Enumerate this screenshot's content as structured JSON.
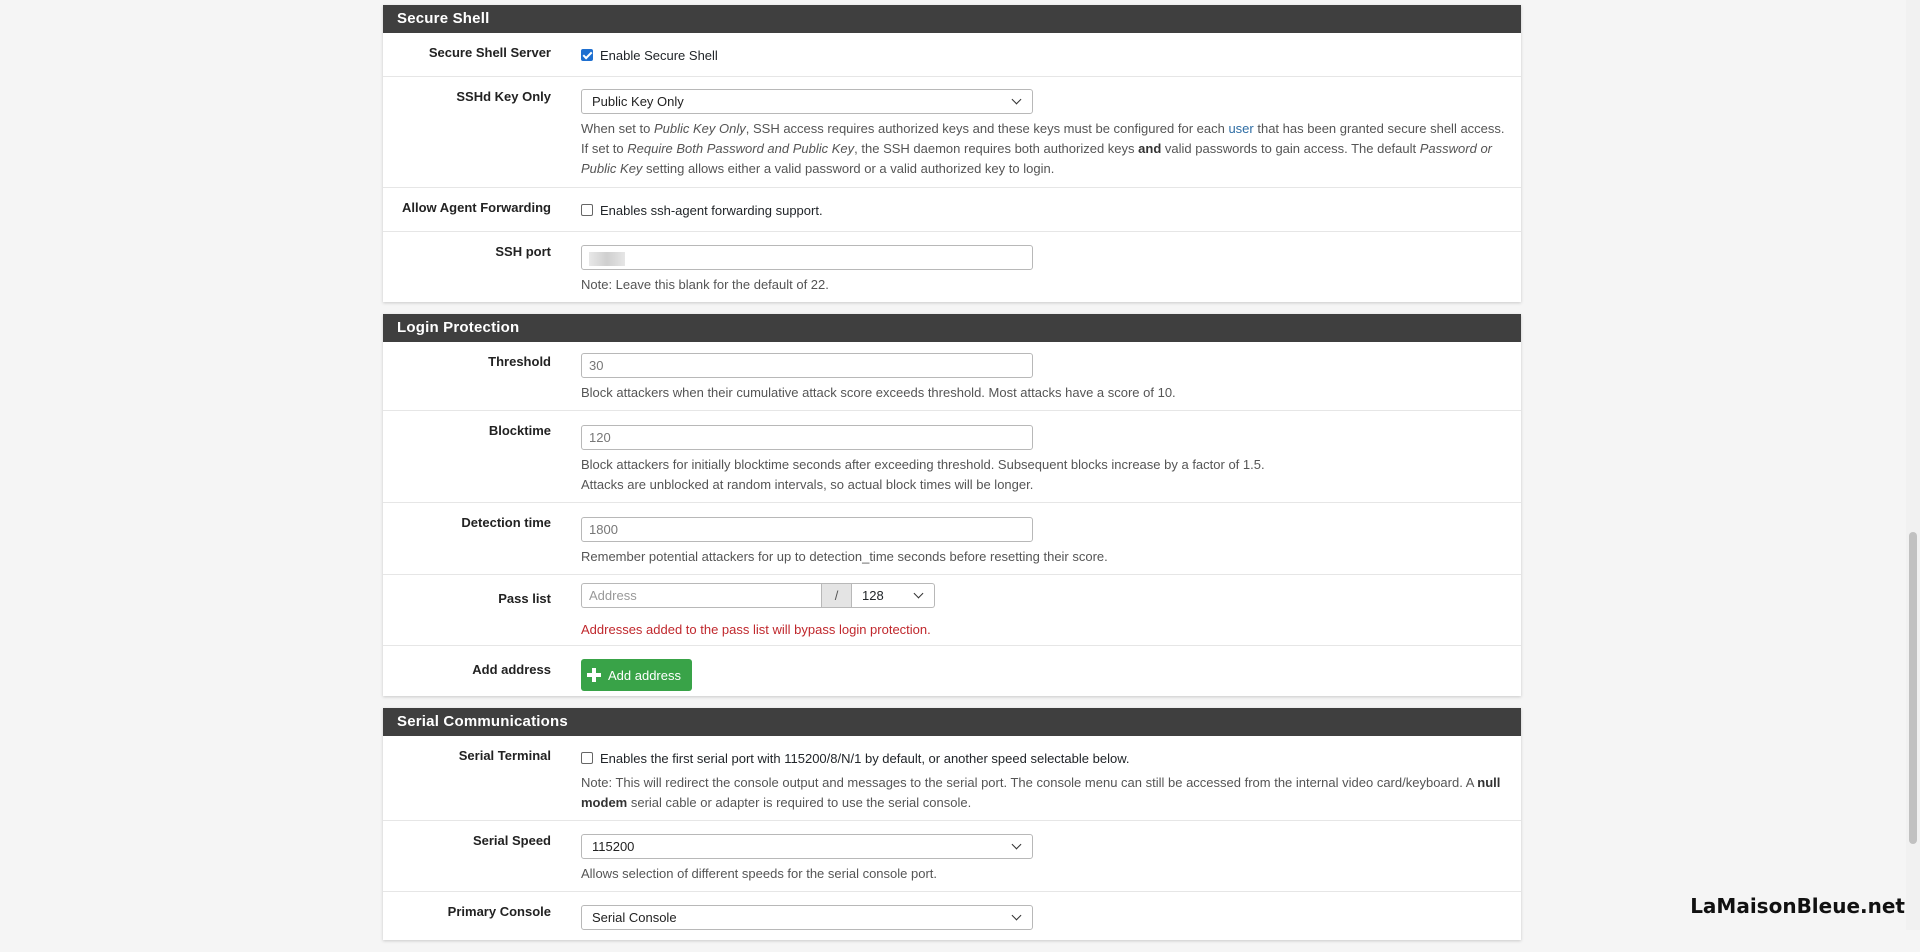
{
  "secure_shell": {
    "title": "Secure Shell",
    "server_label": "Secure Shell Server",
    "server_checkbox": "Enable Secure Shell",
    "server_checked": true,
    "keyonly_label": "SSHd Key Only",
    "keyonly_value": "Public Key Only",
    "keyonly_help": {
      "p1": "When set to ",
      "i1": "Public Key Only",
      "p2": ", SSH access requires authorized keys and these keys must be configured for each ",
      "link": "user",
      "p3": " that has been granted secure shell access. If set to ",
      "i2": "Require Both Password and Public Key",
      "p4": ", the SSH daemon requires both authorized keys ",
      "b1": "and",
      "p5": " valid passwords to gain access. The default ",
      "i3": "Password or Public Key",
      "p6": " setting allows either a valid password or a valid authorized key to login."
    },
    "agent_label": "Allow Agent Forwarding",
    "agent_checkbox": "Enables ssh-agent forwarding support.",
    "agent_checked": false,
    "port_label": "SSH port",
    "port_help": "Note: Leave this blank for the default of 22."
  },
  "login_protection": {
    "title": "Login Protection",
    "threshold_label": "Threshold",
    "threshold_placeholder": "30",
    "threshold_help": "Block attackers when their cumulative attack score exceeds threshold. Most attacks have a score of 10.",
    "blocktime_label": "Blocktime",
    "blocktime_placeholder": "120",
    "blocktime_help1": "Block attackers for initially blocktime seconds after exceeding threshold. Subsequent blocks increase by a factor of 1.5.",
    "blocktime_help2": "Attacks are unblocked at random intervals, so actual block times will be longer.",
    "detection_label": "Detection time",
    "detection_placeholder": "1800",
    "detection_help": "Remember potential attackers for up to detection_time seconds before resetting their score.",
    "passlist_label": "Pass list",
    "passlist_placeholder": "Address",
    "passlist_slash": "/",
    "passlist_cidr": "128",
    "passlist_warning": "Addresses added to the pass list will bypass login protection.",
    "add_label": "Add address",
    "add_button": "Add address"
  },
  "serial": {
    "title": "Serial Communications",
    "terminal_label": "Serial Terminal",
    "terminal_checkbox": "Enables the first serial port with 115200/8/N/1 by default, or another speed selectable below.",
    "terminal_checked": false,
    "terminal_help": {
      "p1": "Note: This will redirect the console output and messages to the serial port. The console menu can still be accessed from the internal video card/keyboard. A ",
      "b1": "null modem",
      "p2": " serial cable or adapter is required to use the serial console."
    },
    "speed_label": "Serial Speed",
    "speed_value": "115200",
    "speed_help": "Allows selection of different speeds for the serial console port.",
    "console_label": "Primary Console",
    "console_value": "Serial Console"
  },
  "watermark": "LaMaisonBleue.net",
  "colors": {
    "panel_heading": "#3f3f3f",
    "add_button": "#39a348",
    "warning_text": "#c0282d",
    "checkbox_checked": "#1e6fd0",
    "link": "#2e6da4"
  }
}
